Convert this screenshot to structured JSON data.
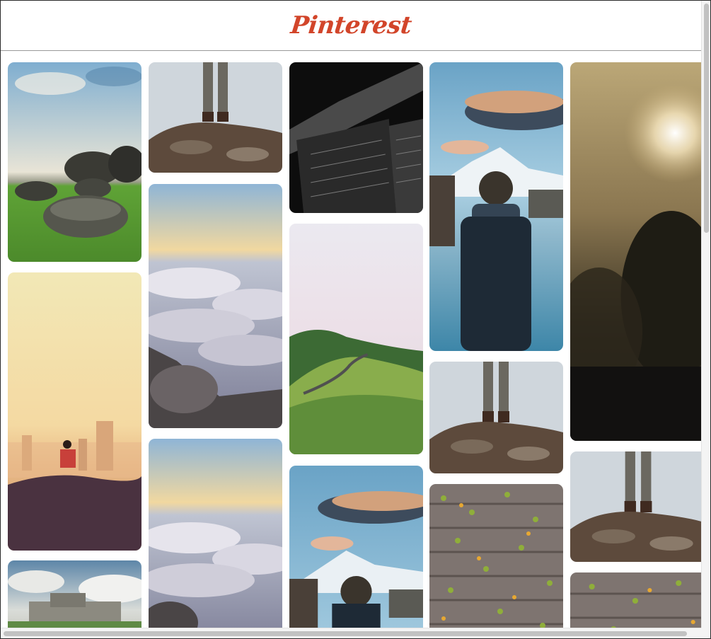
{
  "header": {
    "logo_text": "Pinterest"
  },
  "feed": {
    "pins": [
      {
        "subject": "boulders-in-meadow-photo"
      },
      {
        "subject": "runner-at-sunrise-city-photo"
      },
      {
        "subject": "chateau-under-clouds-photo"
      },
      {
        "subject": "hiker-legs-on-rocks-photo"
      },
      {
        "subject": "sea-of-clouds-photo"
      },
      {
        "subject": "sea-of-clouds-photo"
      },
      {
        "subject": "dark-building-architecture-photo"
      },
      {
        "subject": "green-hills-winding-road-photo"
      },
      {
        "subject": "man-facing-mountain-lake-photo"
      },
      {
        "subject": "man-facing-mountain-lake-photo"
      },
      {
        "subject": "hiker-legs-on-rocks-photo"
      },
      {
        "subject": "wooden-planks-with-leaves-photo"
      },
      {
        "subject": "misty-sunrise-trees-photo"
      },
      {
        "subject": "hiker-legs-on-rocks-photo"
      },
      {
        "subject": "wooden-planks-with-leaves-photo"
      }
    ]
  },
  "colors": {
    "brand": "#d2452a"
  }
}
